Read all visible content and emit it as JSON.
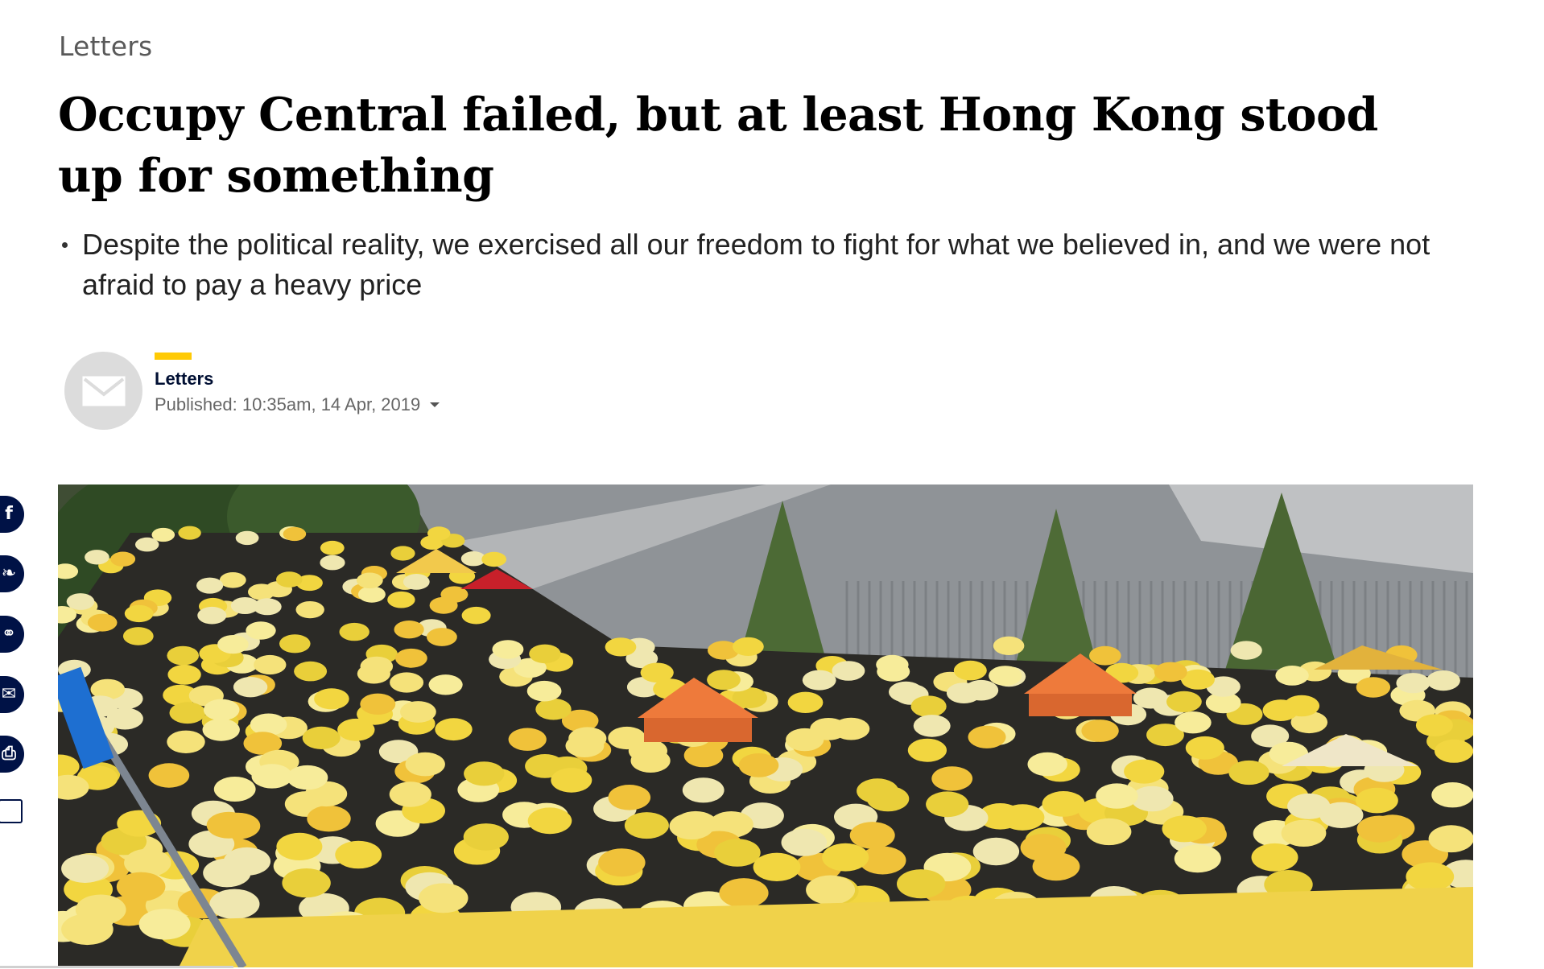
{
  "article": {
    "section": "Letters",
    "headline": "Occupy Central failed, but at least Hong Kong stood up for something",
    "summary": [
      "Despite the political reality, we exercised all our freedom to fight for what we believed in, and we were not afraid to pay a heavy price"
    ]
  },
  "author": {
    "name": "Letters",
    "avatar_icon": "envelope-icon",
    "published": "Published: 10:35am, 14 Apr, 2019",
    "accent_color": "#ffca05"
  },
  "share_rail": {
    "color": "#001246",
    "buttons": [
      {
        "icon": "facebook-icon",
        "glyph": "f"
      },
      {
        "icon": "twitter-icon",
        "glyph": "❧"
      },
      {
        "icon": "link-icon",
        "glyph": "⚭"
      },
      {
        "icon": "email-icon",
        "glyph": "✉"
      },
      {
        "icon": "print-icon",
        "glyph": "⎙"
      }
    ],
    "bookmark_icon": "bookmark-icon"
  },
  "hero_image": {
    "icon": "protest-photo",
    "colors": {
      "umbrella_yellow": "#f2d640",
      "tent_orange": "#ee7a3b",
      "tent_red": "#c8202a",
      "foliage": "#3e5a2c",
      "building": "#9b9ea1"
    }
  }
}
